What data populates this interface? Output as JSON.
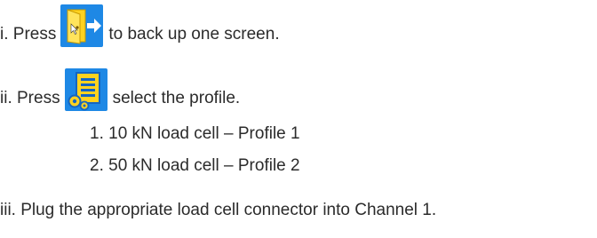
{
  "steps": {
    "step1": {
      "prefix": "i. Press",
      "icon": "exit-door-icon",
      "suffix": "to back up one screen."
    },
    "step2": {
      "prefix": "ii. Press",
      "icon": "profile-settings-icon",
      "suffix": "select the profile.",
      "options": [
        "1. 10 kN load cell – Profile 1",
        "2. 50 kN load cell – Profile 2"
      ]
    },
    "step3": {
      "text": "iii. Plug the appropriate load cell connector into Channel 1."
    }
  },
  "colors": {
    "text": "#2b2b2b",
    "icon_blue": "#1e88e5",
    "icon_yellow": "#ffd21f"
  }
}
